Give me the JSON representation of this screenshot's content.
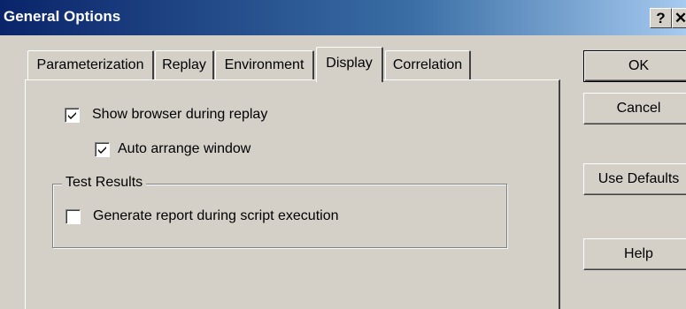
{
  "window": {
    "title": "General Options",
    "help_glyph": "?",
    "close_glyph": "✕"
  },
  "tabs": [
    {
      "label": "Parameterization",
      "active": false
    },
    {
      "label": "Replay",
      "active": false
    },
    {
      "label": "Environment",
      "active": false
    },
    {
      "label": "Display",
      "active": true
    },
    {
      "label": "Correlation",
      "active": false
    }
  ],
  "display": {
    "show_browser": {
      "label": "Show browser during replay",
      "checked": true
    },
    "auto_arrange": {
      "label": "Auto arrange window",
      "checked": true
    },
    "test_results": {
      "title": "Test Results",
      "generate_report": {
        "label": "Generate report during script execution",
        "checked": false
      }
    }
  },
  "buttons": {
    "ok": "OK",
    "cancel": "Cancel",
    "use_defaults": "Use Defaults",
    "help": "Help"
  },
  "icons": {
    "help": "question-mark-icon",
    "close": "close-icon",
    "check": "checkmark-icon"
  }
}
